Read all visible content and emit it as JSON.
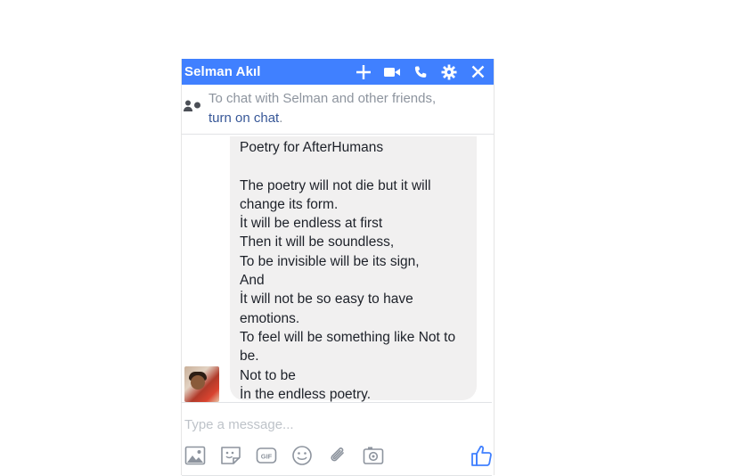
{
  "chat": {
    "title": "Selman Akıl",
    "notice": {
      "text": "To chat with Selman and other friends,",
      "link": "turn on chat",
      "suffix": "."
    },
    "message": {
      "text": "Poetry for AfterHumans\n\nThe poetry will not die but it will change its form.\nİt will be endless at first\nThen it will be soundless,\nTo be invisible will be its sign,\nAnd\nİt will not be so easy to have emotions.\nTo feel will be something like Not to be.\nNot to be\nİn the endless poetry."
    },
    "composer": {
      "placeholder": "Type a message...",
      "tools": [
        "image-icon",
        "sticker-icon",
        "gif-icon",
        "emoji-icon",
        "attachment-icon",
        "camera-icon",
        "thumbs-up-icon"
      ]
    },
    "icons": [
      "add-icon",
      "video-call-icon",
      "phone-icon",
      "gear-icon",
      "close-icon"
    ]
  },
  "colors": {
    "header": "#4080ff",
    "bubble": "#f1f0f0",
    "link": "#385898",
    "icon": "#8d949e",
    "like": "#4080ff"
  }
}
